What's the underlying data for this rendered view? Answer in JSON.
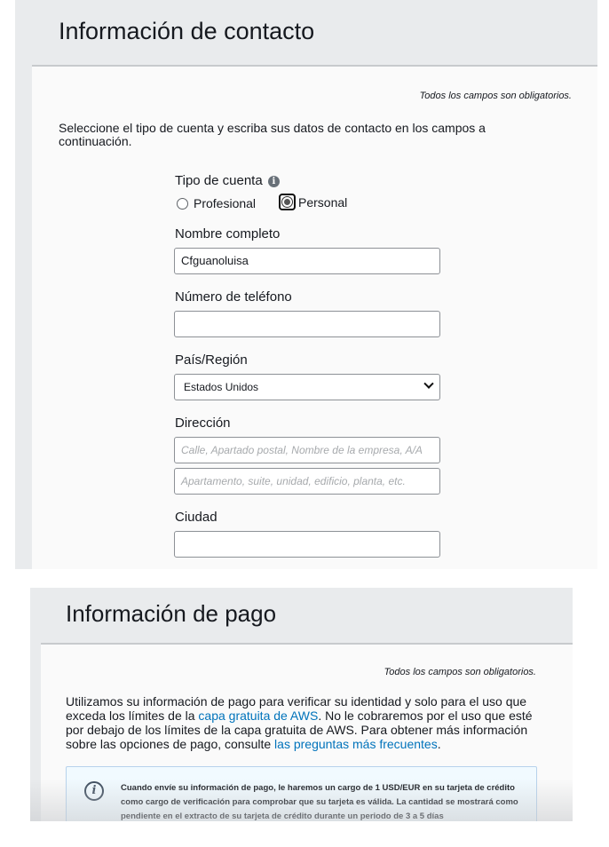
{
  "contact": {
    "title": "Información de contacto",
    "required_note": "Todos los campos son obligatorios.",
    "intro": "Seleccione el tipo de cuenta y escriba sus datos de contacto en los campos a continuación.",
    "account_type": {
      "label": "Tipo de cuenta",
      "info_glyph": "i",
      "options": [
        "Profesional",
        "Personal"
      ],
      "selected": "Personal"
    },
    "full_name": {
      "label": "Nombre completo",
      "value": "Cfguanoluisa"
    },
    "phone": {
      "label": "Número de teléfono",
      "value": ""
    },
    "country": {
      "label": "País/Región",
      "selected": "Estados Unidos"
    },
    "address": {
      "label": "Dirección",
      "line1_placeholder": "Calle, Apartado postal, Nombre de la empresa, A/A",
      "line2_placeholder": "Apartamento, suite, unidad, edificio, planta, etc."
    },
    "city": {
      "label": "Ciudad",
      "value": ""
    }
  },
  "payment": {
    "title": "Información de pago",
    "required_note": "Todos los campos son obligatorios.",
    "intro_parts": {
      "p1": "Utilizamos su información de pago para verificar su identidad y solo para el uso que exceda los límites de la ",
      "link1": "capa gratuita de AWS",
      "p2": ". No le cobraremos por el uso que esté por debajo de los límites de la capa gratuita de AWS. Para obtener más información sobre las opciones de pago, consulte ",
      "link2": "las preguntas más frecuentes",
      "p3": "."
    },
    "notice_glyph": "i",
    "notice": "Cuando envíe su información de pago, le haremos un cargo de 1 USD/EUR en su tarjeta de crédito como cargo de verificación para comprobar que su tarjeta es válida. La cantidad se mostrará como pendiente en el extracto de su tarjeta de crédito durante un periodo de 3 a 5 días"
  },
  "colors": {
    "link": "#0073bb",
    "panel_bg": "#e9ebed",
    "card_bg": "#fafafa"
  }
}
